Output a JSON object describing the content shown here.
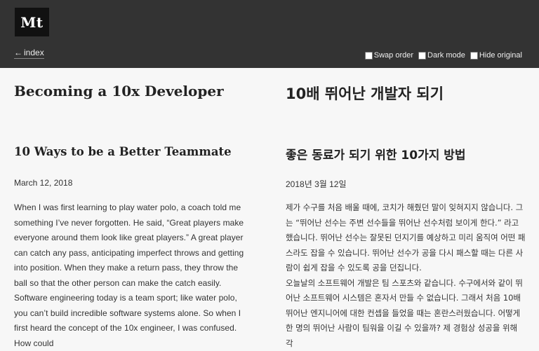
{
  "header": {
    "logo_text": "Mt",
    "index_arrow": "←",
    "index_label": "index",
    "toggles": [
      {
        "label": "Swap order",
        "checked": false
      },
      {
        "label": "Dark mode",
        "checked": false
      },
      {
        "label": "Hide original",
        "checked": false
      }
    ]
  },
  "original": {
    "title": "Becoming a 10x Developer",
    "subtitle": "10 Ways to be a Better Teammate",
    "date": "March 12, 2018",
    "paragraphs": [
      "When I was first learning to play water polo, a coach told me something I’ve never forgotten. He said, “Great players make everyone around them look like great players.” A great player can catch any pass, anticipating imperfect throws and getting into position. When they make a return pass, they throw the ball so that the other person can make the catch easily.",
      "Software engineering today is a team sport; like water polo, you can’t build incredible software systems alone. So when I first heard the concept of the 10x engineer, I was confused. How could"
    ]
  },
  "translation": {
    "title": "10배 뛰어난 개발자 되기",
    "subtitle": "좋은 동료가 되기 위한 10가지 방법",
    "date": "2018년 3월 12일",
    "paragraphs": [
      "제가 수구를 처음 배울 때에, 코치가 해줬던 말이 잊혀지지 않습니다. 그는 “뛰어난 선수는 주변 선수들을 뛰어난 선수처럼 보이게 한다.” 라고 했습니다. 뛰어난 선수는 잘못된 던지기를 예상하고 미리 움직여 어떤 패스라도 잡을 수 있습니다. 뛰어난 선수가 공을 다시 패스할 때는 다른 사람이 쉽게 잡을 수 있도록 공을 던집니다.",
      "오늘날의 소프트웨어 개발은 팀 스포츠와 같습니다. 수구에서와 같이 뛰어난 소프트웨어 시스템은 혼자서 만들 수 없습니다. 그래서 처음 10배 뛰어난 엔지니어에 대한 컨셉을 들었을 때는 혼란스러웠습니다. 어떻게 한 명의 뛰어난 사람이 팀워을 이길 수 있을까? 제 경험상 성공을 위해 각"
    ]
  }
}
